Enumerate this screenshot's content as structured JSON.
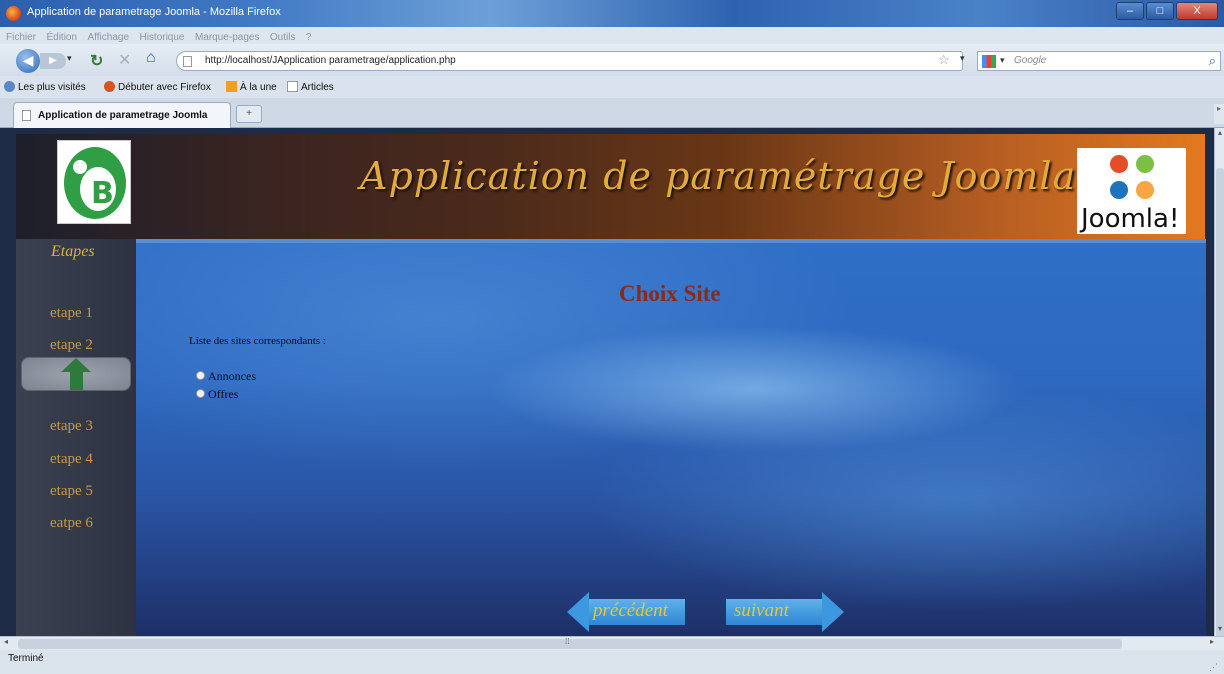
{
  "browser": {
    "window_title": "Application de parametrage Joomla - Mozilla Firefox",
    "menu": [
      "Fichier",
      "Édition",
      "Affichage",
      "Historique",
      "Marque-pages",
      "Outils",
      "?"
    ],
    "url": "http://localhost/JApplication parametrage/application.php",
    "search_placeholder": "Google",
    "bookmarks": [
      "Les plus visités",
      "Débuter avec Firefox",
      "À la une",
      "Articles"
    ],
    "tab_label": "Application de parametrage Joomla",
    "new_tab_label": "+",
    "status": "Terminé",
    "window_buttons": [
      "–",
      "□",
      "X"
    ]
  },
  "app": {
    "banner_title": "Application de paramétrage Joomla",
    "right_logo_text": "Joomla!",
    "sidebar": {
      "title": "Etapes",
      "steps": [
        "etape 1",
        "etape 2",
        "etape 3",
        "etape 4",
        "etape 5",
        "eatpe 6"
      ],
      "current_step": 2
    },
    "page_title": "Choix Site",
    "list_label": "Liste des sites correspondants :",
    "options": [
      "Annonces",
      "Offres"
    ],
    "nav": {
      "prev": "précédent",
      "next": "suivant"
    }
  },
  "colors": {
    "title_gold": "#e2ab3a",
    "step_gold": "#c89a43",
    "page_title_red": "#8a2a18",
    "main_blue": "#2d69c0",
    "nav_text_yellow": "#e2c83a"
  }
}
